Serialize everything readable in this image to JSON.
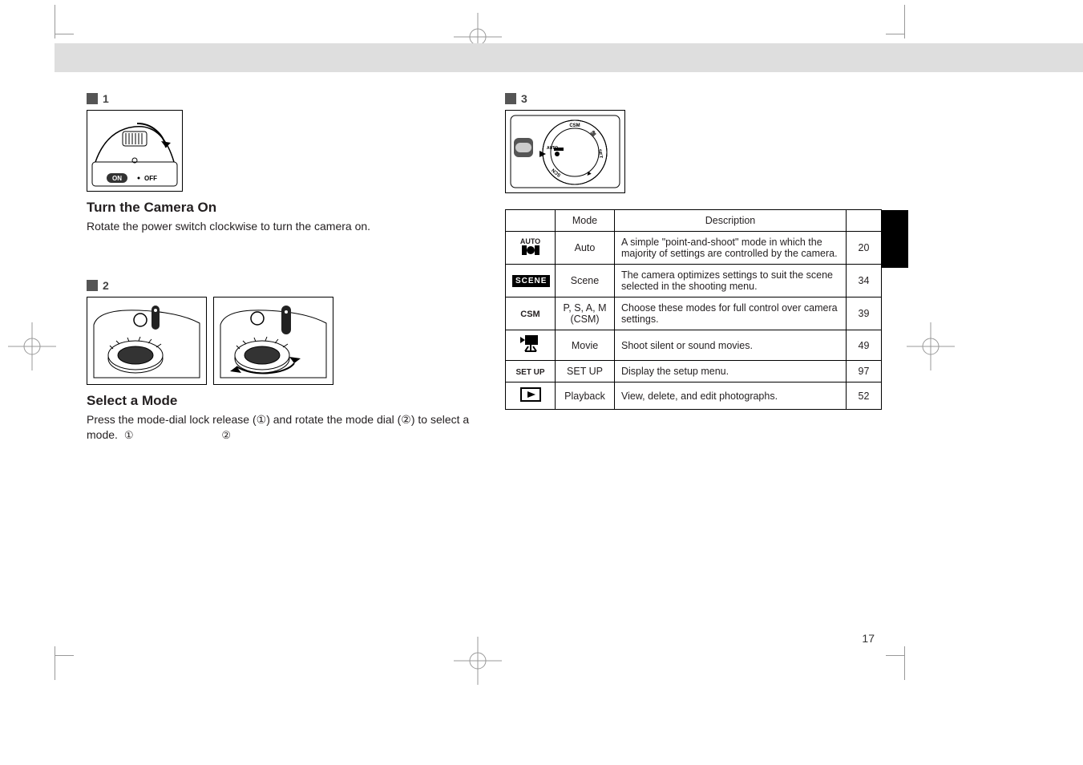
{
  "page_number": "17",
  "title_band": "",
  "left": {
    "step1_label": "1",
    "step1_title": "Turn the Camera On",
    "step1_body": "Rotate the power switch clockwise to turn the camera on.",
    "step2_label": "2",
    "step2_title": "Select a Mode",
    "step2_body_1": "Press the mode-dial lock release (①) and rotate the mode dial (②) to select a mode."
  },
  "right": {
    "step3_label": "3",
    "step3_title": "",
    "table": {
      "headers": [
        "",
        "Mode",
        "Description",
        ""
      ],
      "rows": [
        {
          "icon": "auto",
          "name": "Auto",
          "desc": "A simple \"point-and-shoot\" mode in which the majority of settings are controlled by the camera.",
          "page": "20"
        },
        {
          "icon": "scene",
          "name": "Scene",
          "desc": "The camera optimizes settings to suit the scene selected in the shooting menu.",
          "page": "34"
        },
        {
          "icon": "csm",
          "name": "P, S, A, M (CSM)",
          "desc": "Choose these modes for full control over camera settings.",
          "page": "39"
        },
        {
          "icon": "movie",
          "name": "Movie",
          "desc": "Shoot silent or sound movies.",
          "page": "49"
        },
        {
          "icon": "setup",
          "name": "SET UP",
          "desc": "Display the setup menu.",
          "page": "97"
        },
        {
          "icon": "play",
          "name": "Playback",
          "desc": "View, delete, and edit photographs.",
          "page": "52"
        }
      ]
    }
  },
  "icons": {
    "auto_top": "AUTO",
    "scene": "SCENE",
    "csm": "CSM",
    "setup": "SET UP"
  }
}
